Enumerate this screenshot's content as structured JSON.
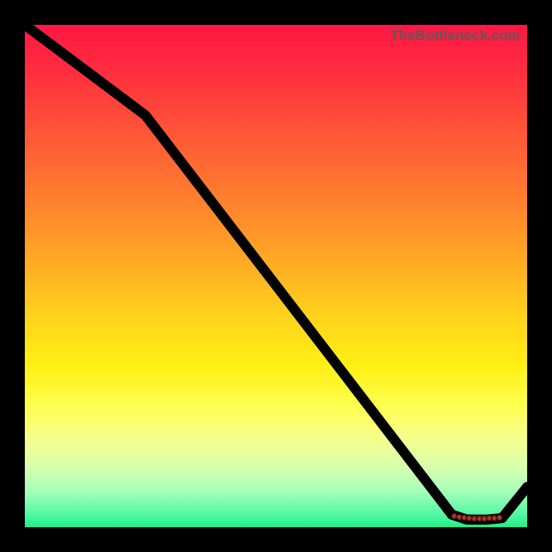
{
  "watermark": "TheBottleneck.com",
  "chart_data": {
    "type": "line",
    "title": "",
    "xlabel": "",
    "ylabel": "",
    "xlim": [
      0,
      100
    ],
    "ylim": [
      0,
      100
    ],
    "x": [
      0,
      24,
      85,
      88,
      92,
      95,
      100
    ],
    "values": [
      100,
      82,
      2.5,
      1.5,
      1.5,
      1.8,
      8
    ],
    "markers": {
      "x": [
        85.5,
        86.5,
        87.5,
        88.5,
        89.5,
        90.5,
        91.5,
        92.5,
        93.5,
        94.5
      ],
      "y": [
        2.2,
        2.0,
        1.9,
        1.8,
        1.7,
        1.7,
        1.7,
        1.8,
        1.8,
        1.9
      ]
    }
  }
}
